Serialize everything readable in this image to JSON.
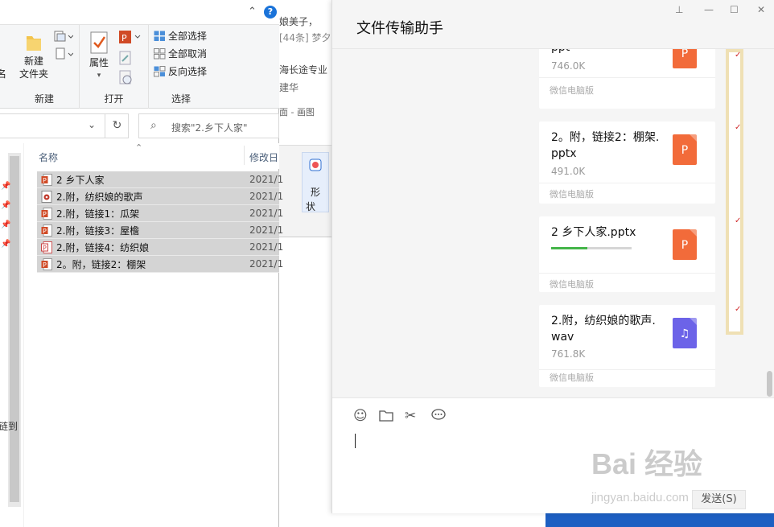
{
  "background_app": {
    "line1": "娘美子，",
    "line2": "[44条] 梦夕:",
    "line3": "海长途专业",
    "line4": "建华",
    "line5": "面 - 画图",
    "shape_label_1": "形",
    "shape_label_2": "状"
  },
  "explorer": {
    "ribbon": {
      "new_folder_line1": "新建",
      "new_folder_line2": "文件夹",
      "new_group": "新建",
      "properties": "属性",
      "open_group": "打开",
      "select_all": "全部选择",
      "select_none": "全部取消",
      "invert_selection": "反向选择",
      "select_group": "选择",
      "left_fragment": "名"
    },
    "search_placeholder": "搜索\"2.乡下人家\"",
    "nav_fragment": "链到",
    "columns": {
      "name": "名称",
      "modified": "修改日"
    },
    "files": [
      {
        "name": "2  乡下人家",
        "date": "2021/1",
        "type": "ppt"
      },
      {
        "name": "2.附，纺织娘的歌声",
        "date": "2021/1",
        "type": "audio"
      },
      {
        "name": "2.附，链接1：瓜架",
        "date": "2021/1",
        "type": "ppt"
      },
      {
        "name": "2.附，链接3：屋檐",
        "date": "2021/1",
        "type": "ppt"
      },
      {
        "name": "2.附，链接4：纺织娘",
        "date": "2021/1",
        "type": "ppt2"
      },
      {
        "name": "2。附，链接2：棚架",
        "date": "2021/1",
        "type": "ppt"
      }
    ]
  },
  "wechat": {
    "title": "文件传输助手",
    "messages": [
      {
        "name": "ppt",
        "size": "746.0K",
        "source": "微信电脑版",
        "icon": "P"
      },
      {
        "name": "2。附，链接2：棚架.pptx",
        "size": "491.0K",
        "source": "微信电脑版",
        "icon": "P"
      },
      {
        "name": "2  乡下人家.pptx",
        "size": "",
        "source": "微信电脑版",
        "icon": "P",
        "progress": 0.45
      },
      {
        "name": "2.附，纺织娘的歌声.wav",
        "size": "761.8K",
        "source": "微信电脑版",
        "icon": "♫"
      }
    ],
    "send_button": "发送(S)",
    "colors": {
      "ppt_icon": "#f26b3a",
      "audio_icon": "#6c63e8",
      "progress": "#44b549"
    }
  },
  "watermark": {
    "main": "Bai 经验",
    "sub": "jingyan.baidu.com"
  }
}
